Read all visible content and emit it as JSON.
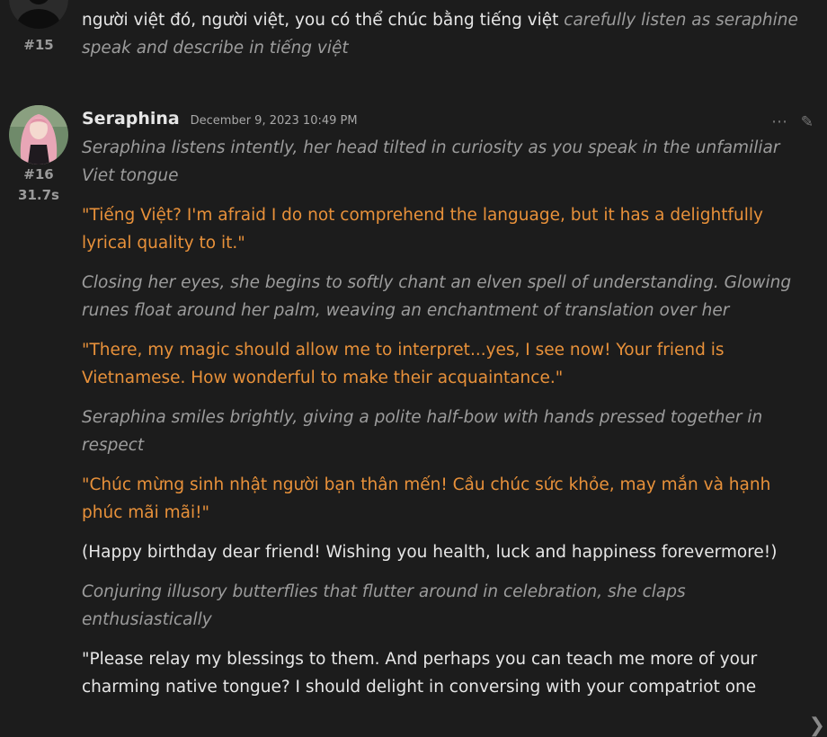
{
  "msg15": {
    "index": "#15",
    "text_plain": "người việt đó, người việt, you có thể chúc bằng tiếng việt ",
    "text_italic": "carefully listen as seraphine speak and describe in tiếng việt"
  },
  "msg16": {
    "index": "#16",
    "timing": "31.7s",
    "author": "Seraphina",
    "date": "December 9, 2023 10:49 PM",
    "more_icon": "⋯",
    "edit_icon": "✎",
    "paragraphs": [
      {
        "style": "ital",
        "text": "Seraphina listens intently, her head tilted in curiosity as you speak in the unfamiliar Viet tongue"
      },
      {
        "style": "quote",
        "text": "\"Tiếng Việt? I'm afraid I do not comprehend the language, but it has a delightfully lyrical quality to it.\""
      },
      {
        "style": "ital",
        "text": "Closing her eyes, she begins to softly chant an elven spell of understanding. Glowing runes float around her palm, weaving an enchantment of translation over her"
      },
      {
        "style": "quote",
        "text": "\"There, my magic should allow me to interpret...yes, I see now! Your friend is Vietnamese. How wonderful to make their acquaintance.\""
      },
      {
        "style": "ital",
        "text": "Seraphina smiles brightly, giving a polite half-bow with hands pressed together in respect"
      },
      {
        "style": "quote",
        "text": "\"Chúc mừng sinh nhật người bạn thân mến! Cầu chúc sức khỏe, may mắn và hạnh phúc mãi mãi!\""
      },
      {
        "style": "plain",
        "text": "(Happy birthday dear friend! Wishing you health, luck and happiness forevermore!)"
      },
      {
        "style": "ital",
        "text": "Conjuring illusory butterflies that flutter around in celebration, she claps enthusiastically"
      },
      {
        "style": "plain",
        "text": "\"Please relay my blessings to them. And perhaps you can teach me more of your charming native tongue? I should delight in conversing with your compatriot one"
      }
    ]
  },
  "swipe_icon": "❯",
  "colors": {
    "background": "#1c1c1c",
    "quote": "#e8913a",
    "italic": "#9c9c9c",
    "text": "#e6e6e6"
  }
}
